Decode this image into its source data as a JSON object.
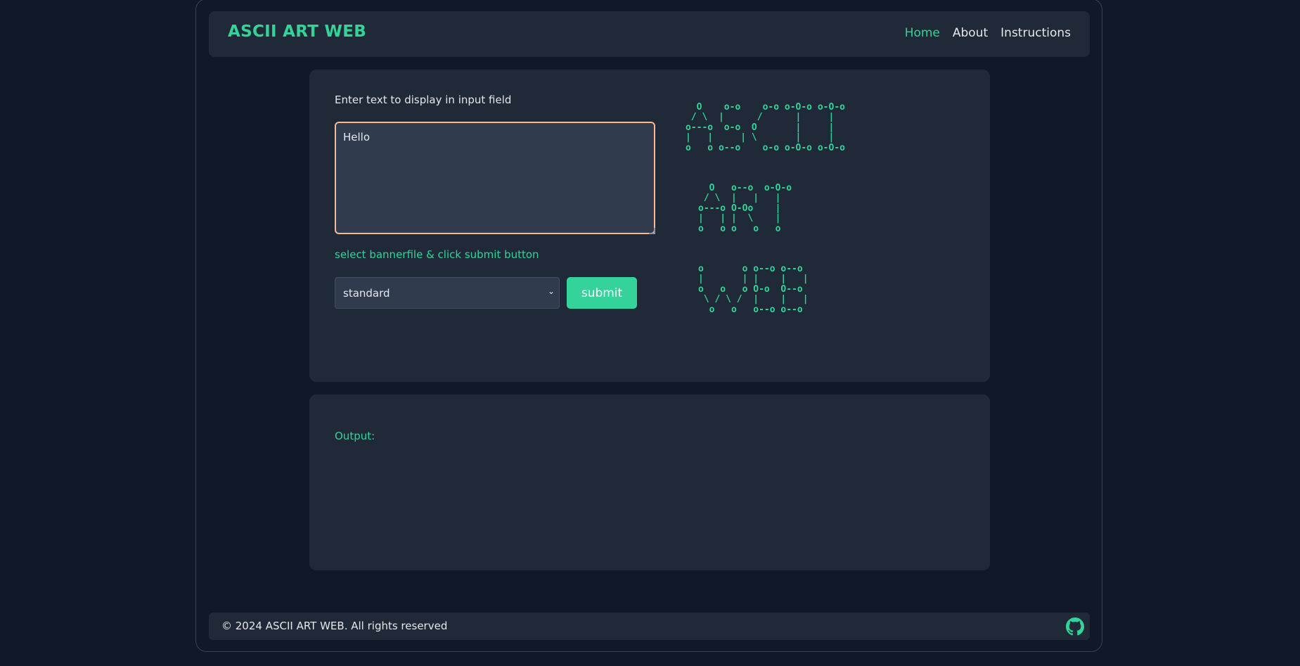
{
  "app": {
    "brand": "ASCII ART WEB"
  },
  "nav": {
    "items": [
      {
        "label": "Home",
        "active": true
      },
      {
        "label": "About",
        "active": false
      },
      {
        "label": "Instructions",
        "active": false
      }
    ]
  },
  "input_card": {
    "prompt_label": "Enter text to display in input field",
    "textarea_value": "Hello",
    "banner_hint": "select bannerfile & click submit button",
    "banner_select": {
      "selected": "standard",
      "options": [
        "standard"
      ]
    },
    "submit_label": "submit",
    "ascii_art": [
      "  O    o-o    o-o o-O-o o-O-o\n / \\  |      /      |     |  \no---o  o-o  O       |     |  \n|   |     | \\       |     |  \no   o o--o    o-o o-O-o o-O-o",
      "  O   o--o  o-O-o\n / \\  |   |   |  \no---o O-Oo    |  \n|   | |  \\    |  \no   o o   o   o  ",
      "o       o o--o o--o \n|       | |    |   |\no   o   o O-o  O--o \n \\ / \\ /  |    |   |\n  o   o   o--o o--o "
    ]
  },
  "output_card": {
    "label": "Output:",
    "content": ""
  },
  "footer": {
    "copyright": "© 2024 ASCII ART WEB. All rights reserved",
    "github_icon": "github-icon"
  },
  "colors": {
    "background": "#111827",
    "surface": "#1f2937",
    "accent": "#34d399",
    "input_bg": "#313b4e",
    "textarea_focus_border": "#f7b992",
    "text": "#e5e7eb"
  }
}
